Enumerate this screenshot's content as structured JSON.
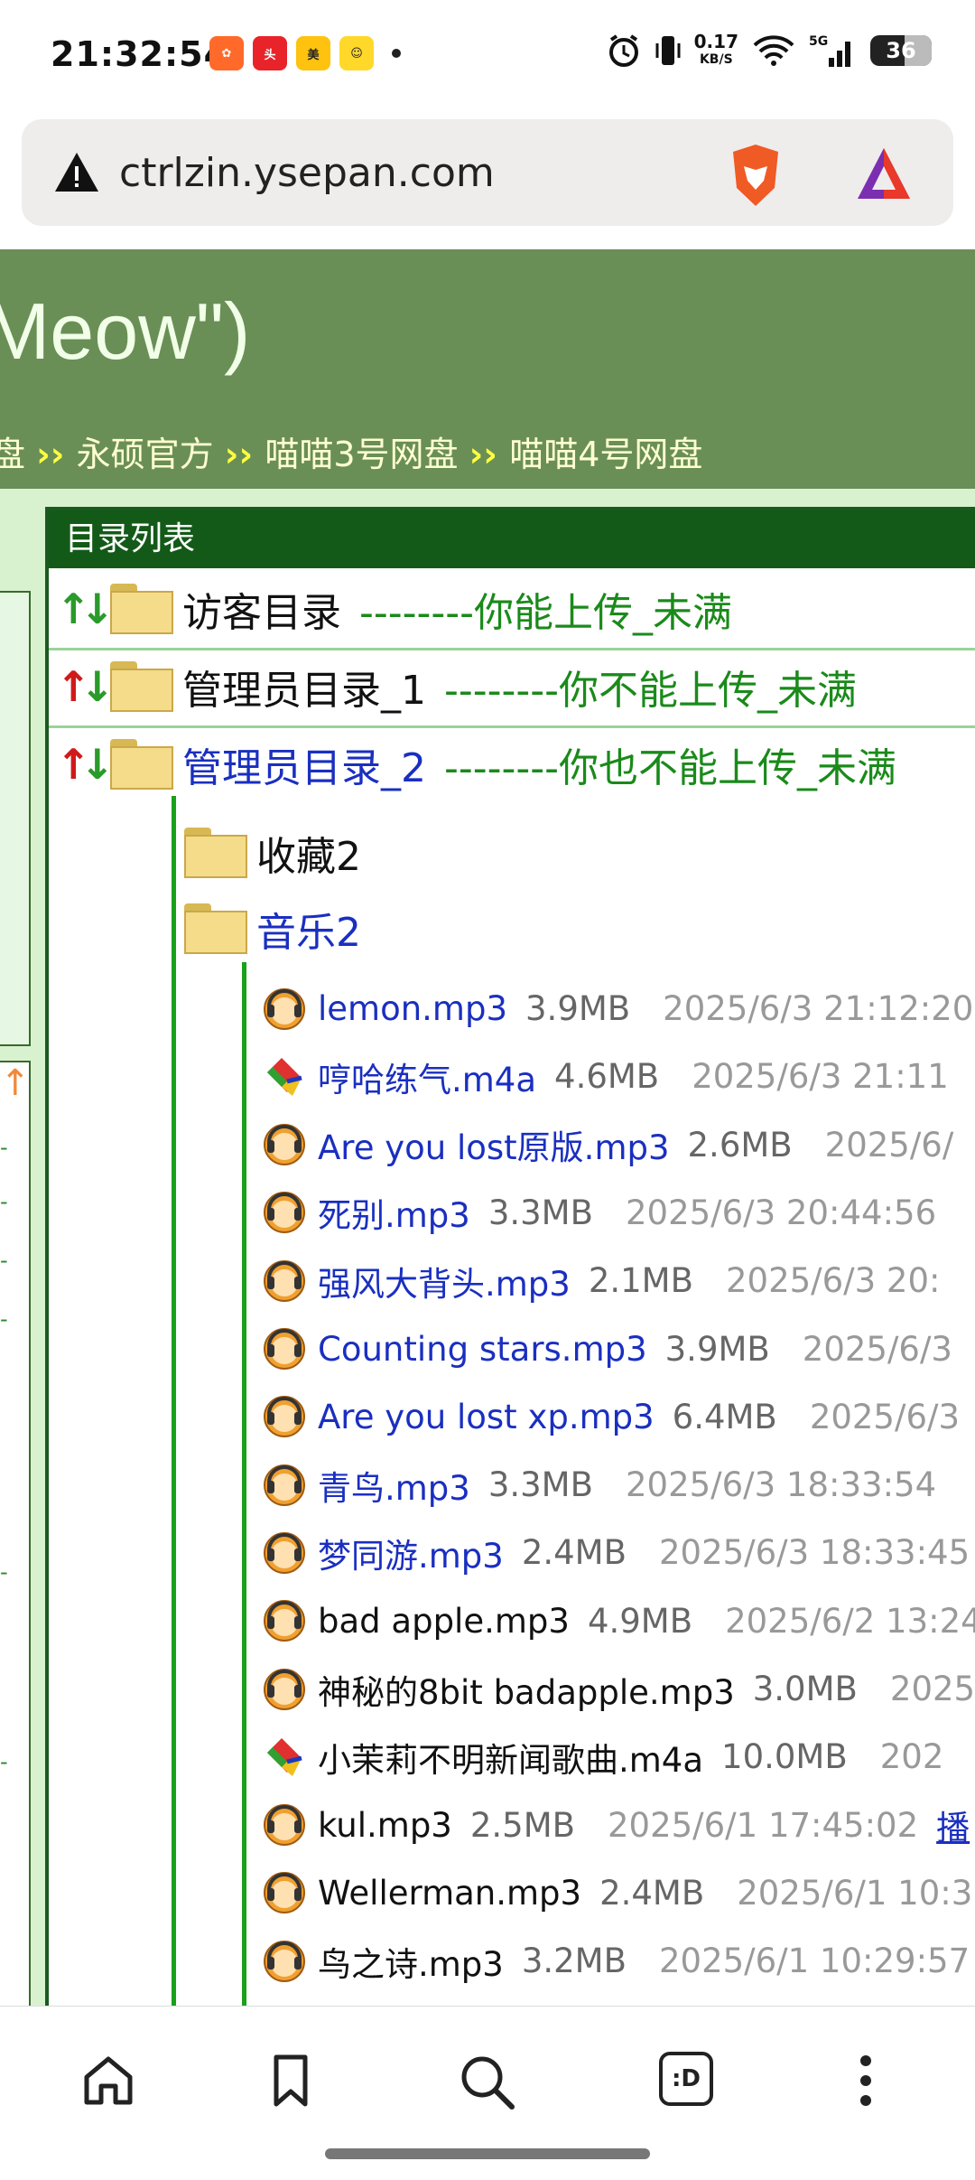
{
  "status": {
    "time": "21:32:54",
    "speed_value": "0.17",
    "speed_unit": "KB/S",
    "network": "5G",
    "battery": "36"
  },
  "browser": {
    "url": "ctrlzin.ysepan.com"
  },
  "site": {
    "title_fragment": "Meow\")",
    "nav_links": [
      "永硕官方",
      "喵喵3号网盘",
      "喵喵4号网盘"
    ],
    "nav_prefix": "盘",
    "panel_title": "目录列表"
  },
  "dirs": [
    {
      "name": "访客目录",
      "note": "--------你能上传_未满",
      "arrow_color": "#2a9a2a"
    },
    {
      "name": "管理员目录_1",
      "note": "--------你不能上传_未满",
      "arrow_color": "#d01a1a"
    },
    {
      "name": "管理员目录_2",
      "note": "--------你也不能上传_未满",
      "arrow_color": "#d01a1a"
    }
  ],
  "subdirs": [
    {
      "name": "收藏2"
    },
    {
      "name": "音乐2"
    }
  ],
  "files": [
    {
      "name": "lemon.mp3",
      "size": "3.9MB",
      "date": "2025/6/3 21:12:20",
      "icon": "mp3-icon",
      "visited": false
    },
    {
      "name": "哼哈练气.m4a",
      "size": "4.6MB",
      "date": "2025/6/3 21:11",
      "icon": "m4a-icon",
      "visited": false
    },
    {
      "name": "Are you lost原版.mp3",
      "size": "2.6MB",
      "date": "2025/6/",
      "icon": "mp3-icon",
      "visited": false
    },
    {
      "name": "死别.mp3",
      "size": "3.3MB",
      "date": "2025/6/3 20:44:56",
      "icon": "mp3-icon",
      "visited": false
    },
    {
      "name": "强风大背头.mp3",
      "size": "2.1MB",
      "date": "2025/6/3 20:",
      "icon": "mp3-icon",
      "visited": false
    },
    {
      "name": "Counting stars.mp3",
      "size": "3.9MB",
      "date": "2025/6/3",
      "icon": "mp3-icon",
      "visited": false
    },
    {
      "name": "Are you lost xp.mp3",
      "size": "6.4MB",
      "date": "2025/6/3",
      "icon": "mp3-icon",
      "visited": false
    },
    {
      "name": "青鸟.mp3",
      "size": "3.3MB",
      "date": "2025/6/3 18:33:54",
      "icon": "mp3-icon",
      "visited": false
    },
    {
      "name": "梦同游.mp3",
      "size": "2.4MB",
      "date": "2025/6/3 18:33:45",
      "icon": "mp3-icon",
      "visited": false
    },
    {
      "name": "bad apple.mp3",
      "size": "4.9MB",
      "date": "2025/6/2 13:24",
      "icon": "mp3-icon",
      "visited": true
    },
    {
      "name": "神秘的8bit badapple.mp3",
      "size": "3.0MB",
      "date": "2025",
      "icon": "mp3-icon",
      "visited": true
    },
    {
      "name": "小茉莉不明新闻歌曲.m4a",
      "size": "10.0MB",
      "date": "202",
      "icon": "m4a-icon",
      "visited": true
    },
    {
      "name": "kul.mp3",
      "size": "2.5MB",
      "date": "2025/6/1 17:45:02",
      "icon": "mp3-icon",
      "visited": true,
      "action": "播"
    },
    {
      "name": "Wellerman.mp3",
      "size": "2.4MB",
      "date": "2025/6/1 10:3",
      "icon": "mp3-icon",
      "visited": true
    },
    {
      "name": "鸟之诗.mp3",
      "size": "3.2MB",
      "date": "2025/6/1 10:29:57",
      "icon": "mp3-icon",
      "visited": true
    }
  ],
  "colors": {
    "header_green": "#6a8f56",
    "panel_green": "#135a18",
    "link_blue": "#1a2fc0",
    "note_green": "#1a8a1a"
  },
  "bottom_nav": [
    "home-icon",
    "bookmark-icon",
    "search-icon",
    "tabs-icon",
    "more-icon"
  ],
  "tabs_label": ":D"
}
